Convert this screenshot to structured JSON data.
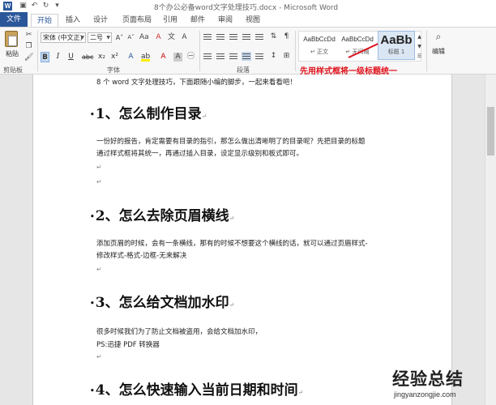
{
  "window": {
    "title": "8个办公必备word文字处理技巧.docx - Microsoft Word",
    "app_icon": "W"
  },
  "tabs": [
    {
      "label": "文件"
    },
    {
      "label": "开始"
    },
    {
      "label": "插入"
    },
    {
      "label": "设计"
    },
    {
      "label": "页面布局"
    },
    {
      "label": "引用"
    },
    {
      "label": "邮件"
    },
    {
      "label": "审阅"
    },
    {
      "label": "视图"
    }
  ],
  "ribbon": {
    "clipboard": {
      "paste_label": "粘贴",
      "group_label": "剪贴板"
    },
    "font": {
      "font_name": "宋体 (中文正)",
      "font_size": "二号",
      "group_label": "字体",
      "buttons": [
        "B",
        "I",
        "U",
        "abc",
        "x₂",
        "x²"
      ]
    },
    "paragraph": {
      "group_label": "段落"
    },
    "styles": {
      "tiles": [
        {
          "sample": "AaBbCcDd",
          "name": "↵ 正文"
        },
        {
          "sample": "AaBbCcDd",
          "name": "↵ 无间隔"
        },
        {
          "sample": "AaBb",
          "name": "标题 1"
        }
      ],
      "group_label": "样式"
    },
    "editing": {
      "label": "编辑"
    }
  },
  "annotation": "先用样式框将一级标题统一",
  "document": {
    "intro": "8 个 word 文字处理技巧，下面跟随小编的脚步，一起来看看吧！",
    "sections": [
      {
        "heading": "1、怎么制作目录",
        "lines": [
          "一份好的报告，肯定需要有目录的指引，那怎么做出清晰明了的目录呢？先把目录的标题",
          "通过样式框将其统一，再通过插入目录，设定显示级别和板式即可。"
        ]
      },
      {
        "heading": "2、怎么去除页眉横线",
        "lines": [
          "添加页眉的时候，会有一条横线，那有的时候不想要这个横线的话，就可以通过页眉样式-",
          "修改样式-格式-边框-无来解决"
        ]
      },
      {
        "heading": "3、怎么给文档加水印",
        "lines": [
          "很多时候我们为了防止文档被盗用，会给文档加水印，",
          "PS:迅捷 PDF 转换器"
        ]
      },
      {
        "heading": "4、怎么快速输入当前日期和时间",
        "lines": []
      }
    ]
  },
  "watermark": {
    "main": "经验总结",
    "sub": "jingyanzongjie.com"
  },
  "colors": {
    "brand": "#2b579a",
    "annotation": "#e0101a"
  }
}
